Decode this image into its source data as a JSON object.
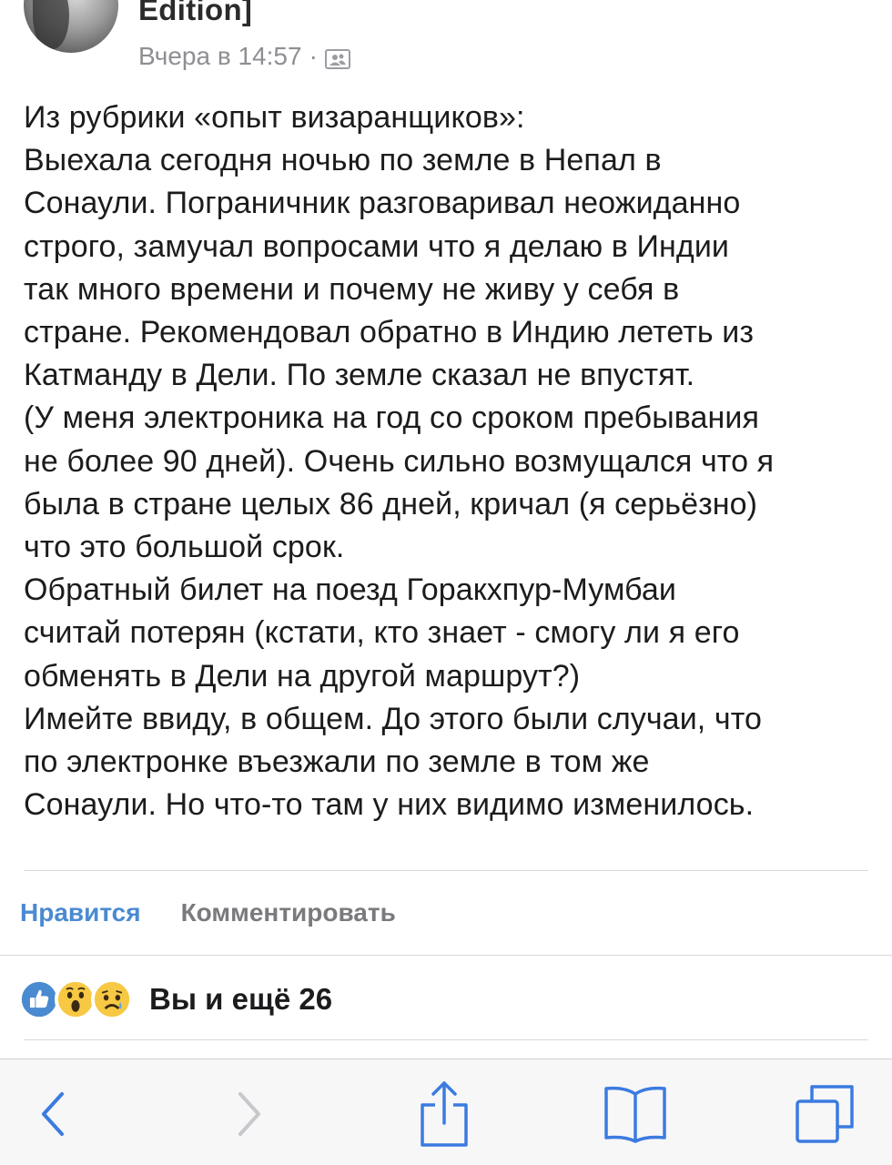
{
  "post": {
    "author_name": "Edition]",
    "timestamp": "Вчера в 14:57",
    "separator": "·",
    "privacy_icon": "friends-icon",
    "text": "Из рубрики «опыт визаранщиков»:\nВыехала сегодня ночью по земле в Непал в\nСонаули. Пограничник разговаривал неожиданно\nстрого, замучал вопросами что я делаю в Индии\nтак много времени и почему не живу у себя в\nстране. Рекомендовал обратно в Индию лететь из\nКатманду в Дели. По земле сказал не впустят.\n(У меня электроника на год со сроком пребывания\nне более 90 дней). Очень сильно возмущался что я\nбыла в стране целых 86 дней, кричал (я серьёзно)\nчто это большой срок.\nОбратный билет на поезд Горакхпур-Мумбаи\nсчитай потерян (кстати, кто знает - смогу ли я его\nобменять в Дели на другой маршрут?)\nИмейте ввиду, в общем. До этого были случаи, что\nпо электронке въезжали по земле в том же\nСонаули. Но что-то там у них видимо изменилось."
  },
  "actions": {
    "like_label": "Нравится",
    "comment_label": "Комментировать"
  },
  "reactions": {
    "icons": [
      "like-reaction-icon",
      "wow-reaction-icon",
      "sad-reaction-icon"
    ],
    "summary": "Вы и ещё 26"
  },
  "toolbar": {
    "items": [
      "back-icon",
      "forward-icon",
      "share-icon",
      "bookmarks-icon",
      "tabs-icon"
    ]
  },
  "colors": {
    "accent": "#4a8ad1",
    "secondary_text": "#8e8e93",
    "toolbar_icon": "#3b7be0",
    "toolbar_icon_disabled": "#c7c7cc"
  }
}
